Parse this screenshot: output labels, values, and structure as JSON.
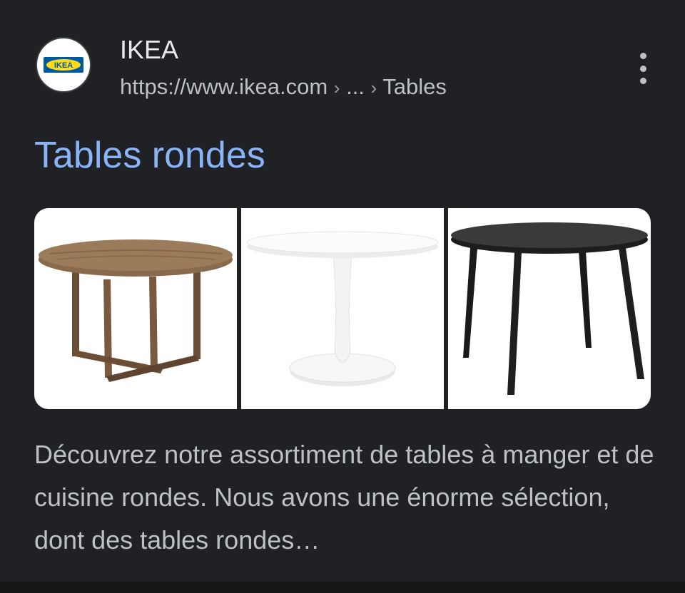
{
  "result": {
    "site_name": "IKEA",
    "url": {
      "domain": "https://www.ikea.com",
      "separator": "›",
      "ellipsis": "...",
      "last_crumb": "Tables"
    },
    "favicon": {
      "logo_text": "IKEA",
      "icon": "ikea-logo-icon",
      "colors": {
        "blue": "#0058a3",
        "yellow": "#ffda1a"
      }
    },
    "more_icon": "vertical-dots-icon",
    "title": "Tables rondes",
    "images": [
      {
        "name": "wooden-round-table",
        "colors": {
          "wood": "#8a6a4c",
          "wood_dark": "#6b4e35"
        }
      },
      {
        "name": "white-tulip-table",
        "colors": {
          "top": "#f4f4f4",
          "shadow": "#dcdcdc"
        }
      },
      {
        "name": "black-round-table",
        "colors": {
          "top": "#2b2b2b",
          "legs": "#1a1a1a"
        }
      }
    ],
    "snippet": "Découvrez notre assortiment de tables à manger et de cuisine rondes. Nous avons une énorme sélection, dont des tables rondes…"
  },
  "theme": {
    "background": "#202124",
    "title_color": "#8ab4f8",
    "text_color": "#bdc1c6"
  }
}
